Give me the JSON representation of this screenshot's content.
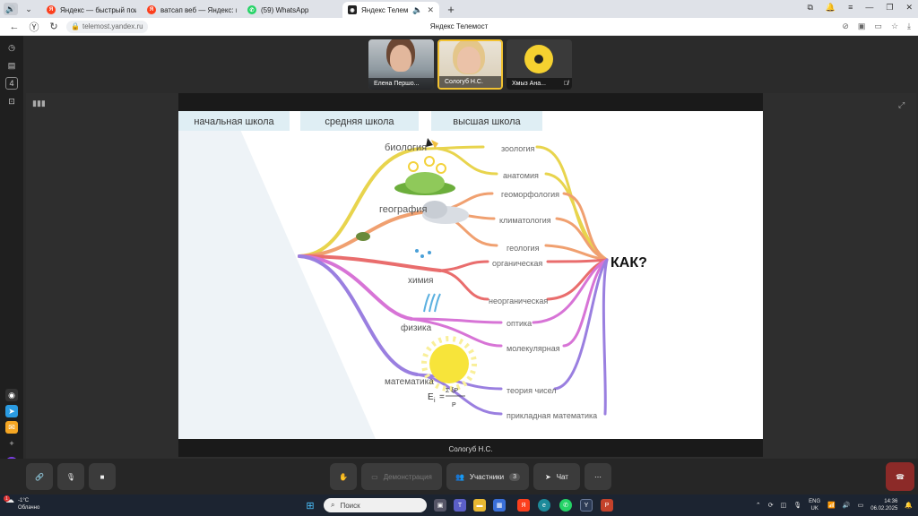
{
  "browser": {
    "tabs": [
      {
        "title": "Яндекс — быстрый поиск",
        "icon": "yandex-icon",
        "active": false
      },
      {
        "title": "ватсап веб — Яндекс: нашлось",
        "icon": "yandex-icon",
        "active": false
      },
      {
        "title": "(59) WhatsApp",
        "icon": "whatsapp-icon",
        "active": false
      },
      {
        "title": "Яндекс Телемост",
        "icon": "telemost-icon",
        "active": true
      }
    ],
    "url": "telemost.yandex.ru",
    "page_title": "Яндекс Телемост"
  },
  "participants": [
    {
      "name": "Елена Першо...",
      "muted": false
    },
    {
      "name": "Сологуб Н.С.",
      "muted": false,
      "active": true
    },
    {
      "name": "Хмыз Ана...",
      "muted": true
    }
  ],
  "stage": {
    "speaker": "Сологуб Н.С."
  },
  "slide": {
    "header_tabs": [
      "начальная школа",
      "средняя школа",
      "высшая школа"
    ],
    "subjects": [
      "биология",
      "география",
      "химия",
      "физика",
      "математика"
    ],
    "branches": [
      "зоология",
      "анатомия",
      "геоморфология",
      "климатология",
      "геология",
      "органическая",
      "неорганическая",
      "оптика",
      "молекулярная",
      "теория чисел",
      "прикладная математика"
    ],
    "question": "КАК?",
    "formula": {
      "left": "E",
      "sub": "i",
      "num": "Σ ξP",
      "den": "P"
    }
  },
  "controls": {
    "demo_label": "Демонстрация",
    "participants_label": "Участники",
    "participants_count": "3",
    "chat_label": "Чат"
  },
  "taskbar": {
    "weather_temp": "-1°C",
    "weather_desc": "Облачно",
    "weather_badge": "1",
    "search_placeholder": "Поиск",
    "lang_top": "ENG",
    "lang_bottom": "UK",
    "time": "14:36",
    "date": "06.02.2025"
  },
  "colors": {
    "biology": "#e8d44d",
    "geography": "#f0a070",
    "chemistry": "#e96d6d",
    "physics": "#d774d6",
    "math": "#9a7fe0",
    "hangup": "#8c2a28",
    "active_border": "#f2c230"
  }
}
